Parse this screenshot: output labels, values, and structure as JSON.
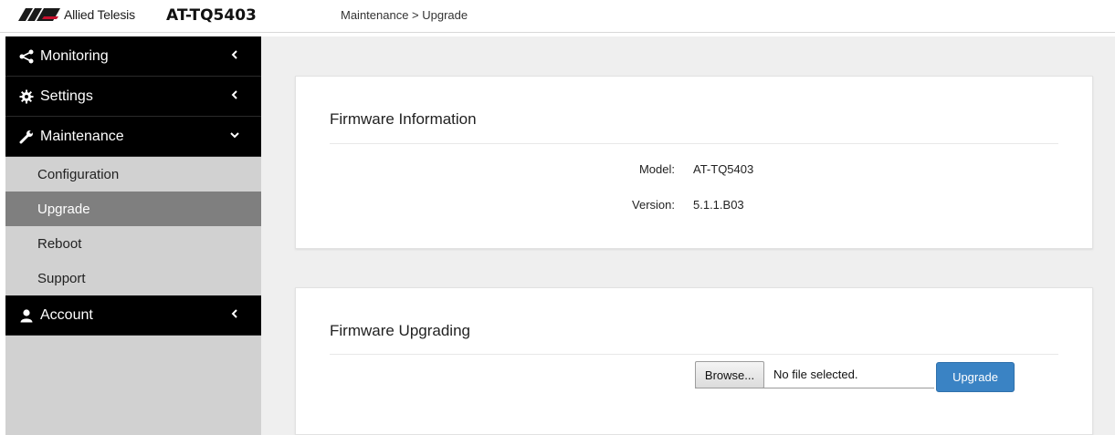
{
  "header": {
    "brand": "Allied Telesis",
    "model": "AT-TQ5403",
    "breadcrumb": "Maintenance > Upgrade",
    "brand_color": "#c8102e"
  },
  "sidebar": {
    "items": [
      {
        "label": "Monitoring",
        "icon": "share-icon",
        "expanded": false
      },
      {
        "label": "Settings",
        "icon": "gear-icon",
        "expanded": false
      },
      {
        "label": "Maintenance",
        "icon": "wrench-icon",
        "expanded": true,
        "children": [
          {
            "label": "Configuration",
            "active": false
          },
          {
            "label": "Upgrade",
            "active": true
          },
          {
            "label": "Reboot",
            "active": false
          },
          {
            "label": "Support",
            "active": false
          }
        ]
      },
      {
        "label": "Account",
        "icon": "user-icon",
        "expanded": false
      }
    ]
  },
  "firmware_info": {
    "title": "Firmware Information",
    "model_key": "Model:",
    "model_value": "AT-TQ5403",
    "version_key": "Version:",
    "version_value": "5.1.1.B03"
  },
  "firmware_upgrade": {
    "title": "Firmware Upgrading",
    "browse_label": "Browse...",
    "file_status": "No file selected.",
    "upgrade_label": "Upgrade"
  },
  "colors": {
    "sidebar_bg": "#d1d1d1",
    "nav_main_bg": "#000000",
    "active_sub_bg": "#7f7f7f",
    "content_bg": "#efefef",
    "primary_button": "#3a83c4"
  }
}
